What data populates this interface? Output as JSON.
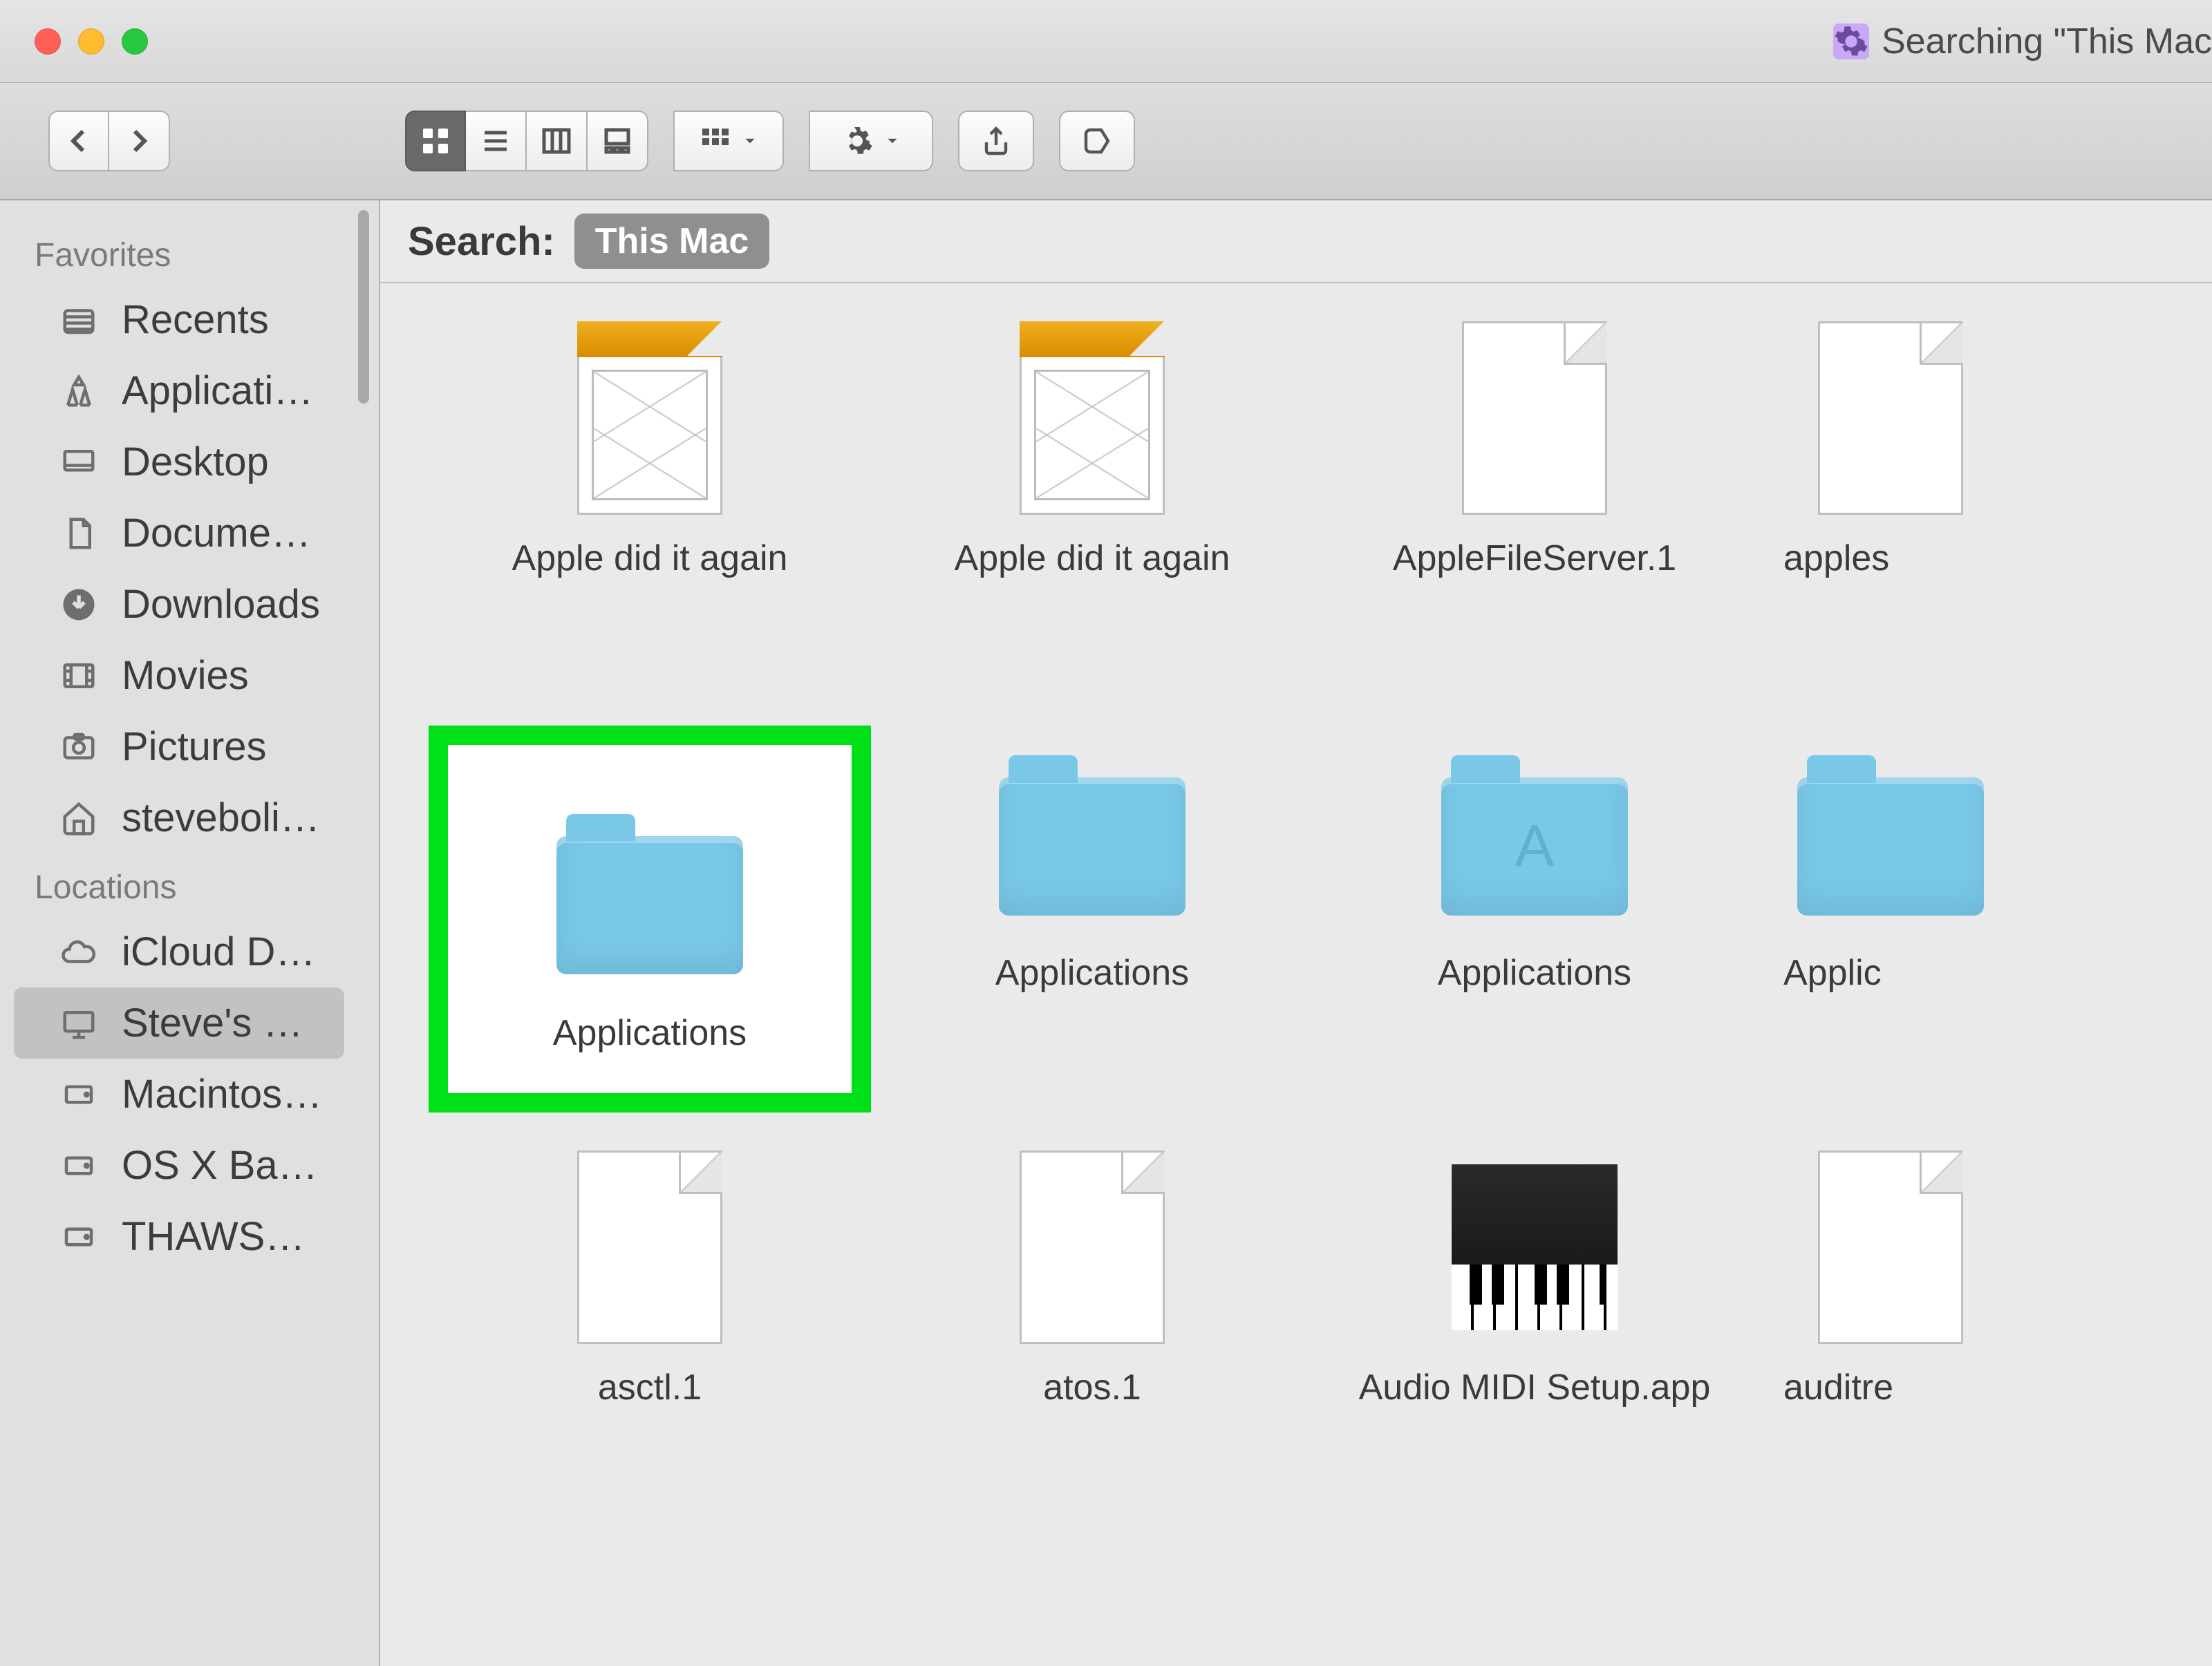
{
  "window": {
    "title_prefix": "Searching",
    "title_quoted": "\"This Mac"
  },
  "search": {
    "label": "Search:",
    "scope": "This Mac"
  },
  "sidebar": {
    "sections": [
      {
        "header": "Favorites",
        "items": [
          {
            "label": "Recents",
            "icon": "recents"
          },
          {
            "label": "Applications",
            "icon": "apps"
          },
          {
            "label": "Desktop",
            "icon": "desktop"
          },
          {
            "label": "Documents",
            "icon": "documents"
          },
          {
            "label": "Downloads",
            "icon": "downloads"
          },
          {
            "label": "Movies",
            "icon": "movies"
          },
          {
            "label": "Pictures",
            "icon": "pictures"
          },
          {
            "label": "stevebolinger",
            "icon": "home"
          }
        ]
      },
      {
        "header": "Locations",
        "items": [
          {
            "label": "iCloud Drive",
            "icon": "icloud"
          },
          {
            "label": "Steve's Mac",
            "icon": "computer",
            "selected": true
          },
          {
            "label": "Macintosh…",
            "icon": "disk"
          },
          {
            "label": "OS X Base…",
            "icon": "disk"
          },
          {
            "label": "THAWSPACE",
            "icon": "disk"
          }
        ]
      }
    ]
  },
  "files": [
    {
      "name": "Apple did it again",
      "kind": "mail"
    },
    {
      "name": "Apple did it again",
      "kind": "mail"
    },
    {
      "name": "AppleFileServer.1",
      "kind": "doc"
    },
    {
      "name": "apples",
      "kind": "doc",
      "partial": true
    },
    {
      "name": "Applications",
      "kind": "folder",
      "highlighted": true
    },
    {
      "name": "Applications",
      "kind": "folder"
    },
    {
      "name": "Applications",
      "kind": "folder-apps"
    },
    {
      "name": "Applic",
      "kind": "folder",
      "partial": true
    },
    {
      "name": "asctl.1",
      "kind": "doc"
    },
    {
      "name": "atos.1",
      "kind": "doc"
    },
    {
      "name": "Audio MIDI Setup.app",
      "kind": "app-audio"
    },
    {
      "name": "auditre",
      "kind": "doc",
      "partial": true
    }
  ]
}
